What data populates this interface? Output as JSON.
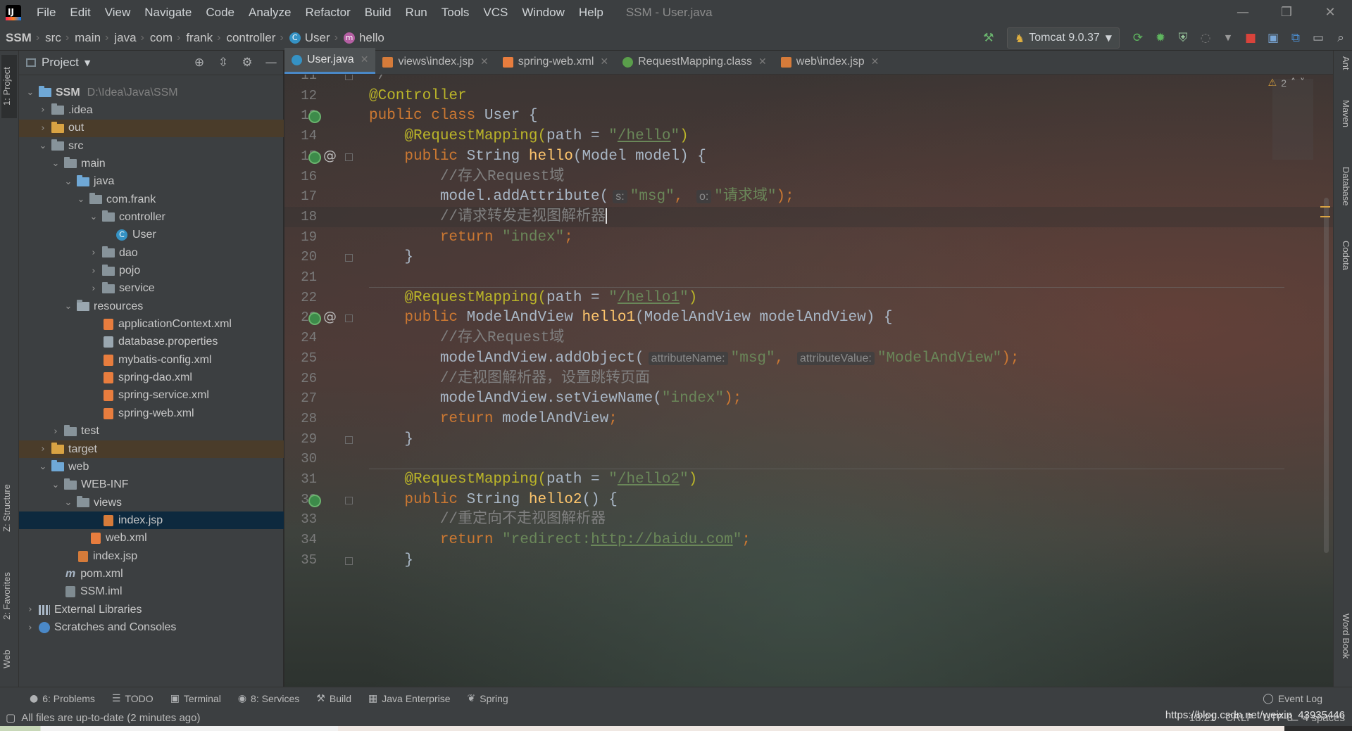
{
  "menu": {
    "items": [
      "File",
      "Edit",
      "View",
      "Navigate",
      "Code",
      "Analyze",
      "Refactor",
      "Build",
      "Run",
      "Tools",
      "VCS",
      "Window",
      "Help"
    ],
    "window_title": "SSM - User.java"
  },
  "breadcrumb": {
    "items": [
      "SSM",
      "src",
      "main",
      "java",
      "com",
      "frank",
      "controller"
    ],
    "class_name": "User",
    "method_name": "hello"
  },
  "run_config": {
    "label": "Tomcat 9.0.37"
  },
  "colors": {
    "accent": "#4a88c7",
    "selected_row": "#0d293e",
    "keyword": "#cc7832",
    "annotation": "#bbb529",
    "string": "#6a8759",
    "comment": "#808080",
    "function": "#ffc66d"
  },
  "left_stripe": {
    "project_tab": "1: Project",
    "structure_tab": "Z: Structure",
    "favorites_tab": "2: Favorites",
    "web_tab": "Web"
  },
  "right_stripe": {
    "ant_tab": "Ant",
    "maven_tab": "Maven",
    "database_tab": "Database",
    "codota_tab": "Codota",
    "wordbook_tab": "Word Book"
  },
  "project_panel": {
    "title": "Project",
    "tree": [
      {
        "label": "SSM",
        "extra": "D:\\Idea\\Java\\SSM",
        "icon": "module-folder-icon",
        "arrow": "v",
        "depth": 0,
        "bold": true
      },
      {
        "label": ".idea",
        "icon": "folder-icon",
        "arrow": ">",
        "depth": 1
      },
      {
        "label": "out",
        "icon": "excluded-folder-icon",
        "arrow": ">",
        "depth": 1,
        "excluded": true
      },
      {
        "label": "src",
        "icon": "folder-icon",
        "arrow": "v",
        "depth": 1
      },
      {
        "label": "main",
        "icon": "folder-icon",
        "arrow": "v",
        "depth": 2
      },
      {
        "label": "java",
        "icon": "source-folder-icon",
        "arrow": "v",
        "depth": 3
      },
      {
        "label": "com.frank",
        "icon": "package-icon",
        "arrow": "v",
        "depth": 4
      },
      {
        "label": "controller",
        "icon": "package-icon",
        "arrow": "v",
        "depth": 5
      },
      {
        "label": "User",
        "icon": "class-icon",
        "arrow": "",
        "depth": 6
      },
      {
        "label": "dao",
        "icon": "package-icon",
        "arrow": ">",
        "depth": 5
      },
      {
        "label": "pojo",
        "icon": "package-icon",
        "arrow": ">",
        "depth": 5
      },
      {
        "label": "service",
        "icon": "package-icon",
        "arrow": ">",
        "depth": 5
      },
      {
        "label": "resources",
        "icon": "resources-folder-icon",
        "arrow": "v",
        "depth": 3
      },
      {
        "label": "applicationContext.xml",
        "icon": "xml-file-icon",
        "arrow": "",
        "depth": 5
      },
      {
        "label": "database.properties",
        "icon": "properties-file-icon",
        "arrow": "",
        "depth": 5
      },
      {
        "label": "mybatis-config.xml",
        "icon": "xml-file-icon",
        "arrow": "",
        "depth": 5
      },
      {
        "label": "spring-dao.xml",
        "icon": "xml-file-icon",
        "arrow": "",
        "depth": 5
      },
      {
        "label": "spring-service.xml",
        "icon": "xml-file-icon",
        "arrow": "",
        "depth": 5
      },
      {
        "label": "spring-web.xml",
        "icon": "xml-file-icon",
        "arrow": "",
        "depth": 5
      },
      {
        "label": "test",
        "icon": "folder-icon",
        "arrow": ">",
        "depth": 2
      },
      {
        "label": "target",
        "icon": "excluded-folder-icon",
        "arrow": ">",
        "depth": 1,
        "excluded": true
      },
      {
        "label": "web",
        "icon": "web-folder-icon",
        "arrow": "v",
        "depth": 1
      },
      {
        "label": "WEB-INF",
        "icon": "folder-icon",
        "arrow": "v",
        "depth": 2
      },
      {
        "label": "views",
        "icon": "folder-icon",
        "arrow": "v",
        "depth": 3
      },
      {
        "label": "index.jsp",
        "icon": "jsp-file-icon",
        "arrow": "",
        "depth": 5,
        "selected": true
      },
      {
        "label": "web.xml",
        "icon": "xml-file-icon",
        "arrow": "",
        "depth": 4
      },
      {
        "label": "index.jsp",
        "icon": "jsp-file-icon",
        "arrow": "",
        "depth": 3
      },
      {
        "label": "pom.xml",
        "icon": "maven-icon",
        "arrow": "",
        "depth": 2
      },
      {
        "label": "SSM.iml",
        "icon": "iml-file-icon",
        "arrow": "",
        "depth": 2
      },
      {
        "label": "External Libraries",
        "icon": "library-icon",
        "arrow": ">",
        "depth": 0
      },
      {
        "label": "Scratches and Consoles",
        "icon": "scratches-icon",
        "arrow": ">",
        "depth": 0
      }
    ]
  },
  "editor_tabs": [
    {
      "label": "User.java",
      "icon": "class-icon",
      "active": true
    },
    {
      "label": "views\\index.jsp",
      "icon": "jsp-file-icon"
    },
    {
      "label": "spring-web.xml",
      "icon": "xml-file-icon"
    },
    {
      "label": "RequestMapping.class",
      "icon": "annotation-class-icon"
    },
    {
      "label": "web\\index.jsp",
      "icon": "jsp-file-icon"
    }
  ],
  "editor": {
    "warning_count": "2",
    "current_line": 18,
    "lines": [
      {
        "n": "11",
        "tokens": [
          {
            "t": "*/",
            "c": "cmt"
          }
        ]
      },
      {
        "n": "12",
        "tokens": [
          {
            "t": "@Controller",
            "c": "ann"
          }
        ]
      },
      {
        "n": "13",
        "tokens": [
          {
            "t": "public class ",
            "c": "kw"
          },
          {
            "t": "User {",
            "c": ""
          }
        ]
      },
      {
        "n": "14",
        "tokens": [
          {
            "t": "    @RequestMapping(",
            "c": "ann"
          },
          {
            "t": "path = ",
            "c": ""
          },
          {
            "t": "\"",
            "c": "str"
          },
          {
            "t": "/hello",
            "c": "str url"
          },
          {
            "t": "\"",
            "c": "str"
          },
          {
            "t": ")",
            "c": "ann"
          }
        ]
      },
      {
        "n": "15",
        "tokens": [
          {
            "t": "    public ",
            "c": "kw"
          },
          {
            "t": "String ",
            "c": ""
          },
          {
            "t": "hello",
            "c": "fn"
          },
          {
            "t": "(Model model) {",
            "c": ""
          }
        ]
      },
      {
        "n": "16",
        "tokens": [
          {
            "t": "        //存入Request域",
            "c": "cmt"
          }
        ]
      },
      {
        "n": "17",
        "tokens": [
          {
            "t": "        model.addAttribute(",
            "c": ""
          },
          {
            "t": "s:",
            "c": "hint"
          },
          {
            "t": "\"msg\"",
            "c": "str"
          },
          {
            "t": ", ",
            "c": "kw"
          },
          {
            "t": "o:",
            "c": "hint"
          },
          {
            "t": "\"请求域\"",
            "c": "str"
          },
          {
            "t": ");",
            "c": "kw"
          }
        ]
      },
      {
        "n": "18",
        "tokens": [
          {
            "t": "        //请求转发走视图解析器",
            "c": "cmt"
          }
        ],
        "caret": true
      },
      {
        "n": "19",
        "tokens": [
          {
            "t": "        return ",
            "c": "kw"
          },
          {
            "t": "\"index\"",
            "c": "str"
          },
          {
            "t": ";",
            "c": "kw"
          }
        ]
      },
      {
        "n": "20",
        "tokens": [
          {
            "t": "    }",
            "c": ""
          }
        ]
      },
      {
        "n": "21",
        "tokens": []
      },
      {
        "n": "22",
        "tokens": [
          {
            "t": "    @RequestMapping(",
            "c": "ann"
          },
          {
            "t": "path = ",
            "c": ""
          },
          {
            "t": "\"",
            "c": "str"
          },
          {
            "t": "/hello1",
            "c": "str url"
          },
          {
            "t": "\"",
            "c": "str"
          },
          {
            "t": ")",
            "c": "ann"
          }
        ]
      },
      {
        "n": "23",
        "tokens": [
          {
            "t": "    public ",
            "c": "kw"
          },
          {
            "t": "ModelAndView ",
            "c": ""
          },
          {
            "t": "hello1",
            "c": "fn"
          },
          {
            "t": "(ModelAndView modelAndView) {",
            "c": ""
          }
        ]
      },
      {
        "n": "24",
        "tokens": [
          {
            "t": "        //存入Request域",
            "c": "cmt"
          }
        ]
      },
      {
        "n": "25",
        "tokens": [
          {
            "t": "        modelAndView.addObject(",
            "c": ""
          },
          {
            "t": "attributeName:",
            "c": "hint"
          },
          {
            "t": "\"msg\"",
            "c": "str"
          },
          {
            "t": ", ",
            "c": "kw"
          },
          {
            "t": "attributeValue:",
            "c": "hint"
          },
          {
            "t": "\"ModelAndView\"",
            "c": "str"
          },
          {
            "t": ");",
            "c": "kw"
          }
        ]
      },
      {
        "n": "26",
        "tokens": [
          {
            "t": "        //走视图解析器，设置跳转页面",
            "c": "cmt"
          }
        ]
      },
      {
        "n": "27",
        "tokens": [
          {
            "t": "        modelAndView.setViewName(",
            "c": ""
          },
          {
            "t": "\"index\"",
            "c": "str"
          },
          {
            "t": ");",
            "c": "kw"
          }
        ]
      },
      {
        "n": "28",
        "tokens": [
          {
            "t": "        return ",
            "c": "kw"
          },
          {
            "t": "modelAndView",
            "c": ""
          },
          {
            "t": ";",
            "c": "kw"
          }
        ]
      },
      {
        "n": "29",
        "tokens": [
          {
            "t": "    }",
            "c": ""
          }
        ]
      },
      {
        "n": "30",
        "tokens": []
      },
      {
        "n": "31",
        "tokens": [
          {
            "t": "    @RequestMapping(",
            "c": "ann"
          },
          {
            "t": "path = ",
            "c": ""
          },
          {
            "t": "\"",
            "c": "str"
          },
          {
            "t": "/hello2",
            "c": "str url"
          },
          {
            "t": "\"",
            "c": "str"
          },
          {
            "t": ")",
            "c": "ann"
          }
        ]
      },
      {
        "n": "32",
        "tokens": [
          {
            "t": "    public ",
            "c": "kw"
          },
          {
            "t": "String ",
            "c": ""
          },
          {
            "t": "hello2",
            "c": "fn"
          },
          {
            "t": "() {",
            "c": ""
          }
        ]
      },
      {
        "n": "33",
        "tokens": [
          {
            "t": "        //重定向不走视图解析器",
            "c": "cmt"
          }
        ]
      },
      {
        "n": "34",
        "tokens": [
          {
            "t": "        return ",
            "c": "kw"
          },
          {
            "t": "\"redirect:",
            "c": "str"
          },
          {
            "t": "http://baidu.com",
            "c": "str url"
          },
          {
            "t": "\"",
            "c": "str"
          },
          {
            "t": ";",
            "c": "kw"
          }
        ]
      },
      {
        "n": "35",
        "tokens": [
          {
            "t": "    }",
            "c": ""
          }
        ]
      }
    ]
  },
  "bottom_tools": [
    {
      "label": "6: Problems",
      "icon": "problems-icon"
    },
    {
      "label": "TODO",
      "icon": "todo-icon"
    },
    {
      "label": "Terminal",
      "icon": "terminal-icon"
    },
    {
      "label": "8: Services",
      "icon": "services-icon"
    },
    {
      "label": "Build",
      "icon": "build-icon"
    },
    {
      "label": "Java Enterprise",
      "icon": "java-enterprise-icon"
    },
    {
      "label": "Spring",
      "icon": "spring-icon"
    }
  ],
  "event_log": "Event Log",
  "statusbar": {
    "message": "All files are up-to-date (2 minutes ago)",
    "position": "18:21",
    "line_sep": "CRLF",
    "encoding": "UTF-8",
    "indent": "4 spaces",
    "watermark": "https://blog.csdn.net/weixin_43935446"
  }
}
